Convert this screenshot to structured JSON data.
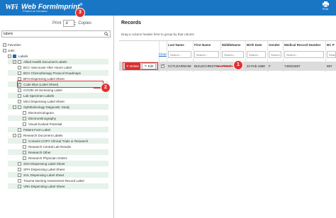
{
  "app": {
    "title": "Web FormImprint",
    "title_mark": "®",
    "subtitle": "Printed on Demand",
    "logo_text": "WFi",
    "brand_color": "#1976c4"
  },
  "header_actions": {
    "print_label": "Print",
    "print_icon": "printer-icon"
  },
  "print_controls": {
    "label_before": "Print",
    "copies_value": "3",
    "label_after": "Copies"
  },
  "search": {
    "value": "labels",
    "icon": "search-icon"
  },
  "tree": {
    "favorites": "Favorites",
    "jobs": "Jobs",
    "labels": "Labels",
    "items": [
      "Allied Health Document Labels",
      "BCC Vancouver After Hours Label",
      "BCH Chemotherapy Protocol Roadmaps",
      "BFH Dispensing Label Sheet",
      "Code Blue (Label Sheet)",
      "COVID-19 Screening Label",
      "Lab Specimen Labels",
      "MSJ Dispensing Label Sheet",
      "Ophthalmology Diagnostic Study",
      "ElectroOculogram",
      "Electroretinography",
      "Visual Evoked Potential",
      "Patient Form Label",
      "Research Document Labels",
      "Consent COPY Clinical Trials or Research",
      "Research Central Lab Results",
      "Research Other",
      "Research Physician Orders",
      "SGH Dispensing Label Sheet",
      "SPH Dispensing Label Sheet",
      "SVL Dispensing Label Sheet",
      "Trauma Nursing Assessment Record Label",
      "VRH Dispensing Label Sheet"
    ]
  },
  "records": {
    "title": "Records",
    "group_hint": "Drag a column header here to group by that column",
    "columns": [
      "Last Name",
      "First Name",
      "MiddleName",
      "Birth Date",
      "Gender",
      "Medical Record Number",
      "BC P"
    ],
    "filter_placeholder": "Search...",
    "clear_label": "Clear",
    "row": {
      "delete_label": "Delete",
      "edit_label": "Edit",
      "last_name": "CCTLEARNHIM",
      "first_name": "BUILDCHRISTINA",
      "middle_name": "PRINT",
      "birth_date": "22-Feb-1968",
      "gender": "F",
      "mrn": "740022697",
      "bc_phn": "987"
    }
  },
  "annotations": {
    "badge_1": "1",
    "badge_2": "2",
    "badge_3": "3",
    "accent": "#e03131"
  }
}
